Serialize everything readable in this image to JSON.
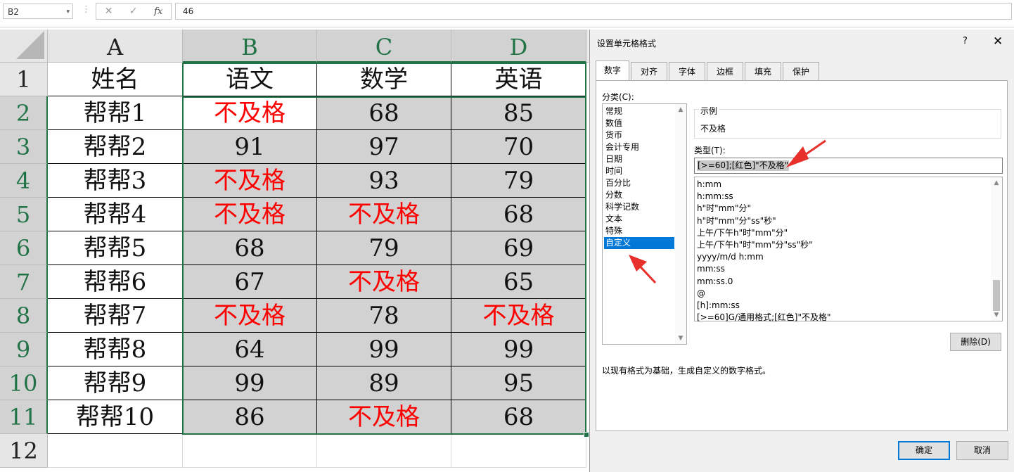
{
  "formula_bar": {
    "name_box": "B2",
    "dropdown_glyph": "▾",
    "separator": "⋮",
    "cancel_glyph": "✕",
    "enter_glyph": "✓",
    "fx_label": "fx",
    "formula": "46"
  },
  "sheet": {
    "columns": [
      "A",
      "B",
      "C",
      "D"
    ],
    "rows": [
      "1",
      "2",
      "3",
      "4",
      "5",
      "6",
      "7",
      "8",
      "9",
      "10",
      "11",
      "12"
    ],
    "header": [
      "姓名",
      "语文",
      "数学",
      "英语"
    ],
    "data": [
      [
        "帮帮1",
        "不及格",
        "68",
        "85"
      ],
      [
        "帮帮2",
        "91",
        "97",
        "70"
      ],
      [
        "帮帮3",
        "不及格",
        "93",
        "79"
      ],
      [
        "帮帮4",
        "不及格",
        "不及格",
        "68"
      ],
      [
        "帮帮5",
        "68",
        "79",
        "69"
      ],
      [
        "帮帮6",
        "67",
        "不及格",
        "65"
      ],
      [
        "帮帮7",
        "不及格",
        "78",
        "不及格"
      ],
      [
        "帮帮8",
        "64",
        "99",
        "99"
      ],
      [
        "帮帮9",
        "99",
        "89",
        "95"
      ],
      [
        "帮帮10",
        "86",
        "不及格",
        "68"
      ]
    ],
    "fail_color": "#ff0000",
    "selection_color": "#217346"
  },
  "dialog": {
    "title": "设置单元格格式",
    "help": "?",
    "close": "✕",
    "tabs": [
      "数字",
      "对齐",
      "字体",
      "边框",
      "填充",
      "保护"
    ],
    "category_label": "分类(C):",
    "categories": [
      "常规",
      "数值",
      "货币",
      "会计专用",
      "日期",
      "时间",
      "百分比",
      "分数",
      "科学记数",
      "文本",
      "特殊",
      "自定义"
    ],
    "selected_category": "自定义",
    "sample_label": "示例",
    "sample_value": "不及格",
    "type_label": "类型(T):",
    "type_value": "[>=60];[红色]\"不及格\"",
    "type_list": [
      "h:mm",
      "h:mm:ss",
      "h\"时\"mm\"分\"",
      "h\"时\"mm\"分\"ss\"秒\"",
      "上午/下午h\"时\"mm\"分\"",
      "上午/下午h\"时\"mm\"分\"ss\"秒\"",
      "yyyy/m/d h:mm",
      "mm:ss",
      "mm:ss.0",
      "@",
      "[h]:mm:ss",
      "[>=60]G/通用格式;[红色]\"不及格\""
    ],
    "delete_button": "删除(D)",
    "description": "以现有格式为基础，生成自定义的数字格式。",
    "ok_button": "确定",
    "cancel_button": "取消",
    "accent_color": "#0078d7",
    "arrow_color": "#e8302a"
  }
}
